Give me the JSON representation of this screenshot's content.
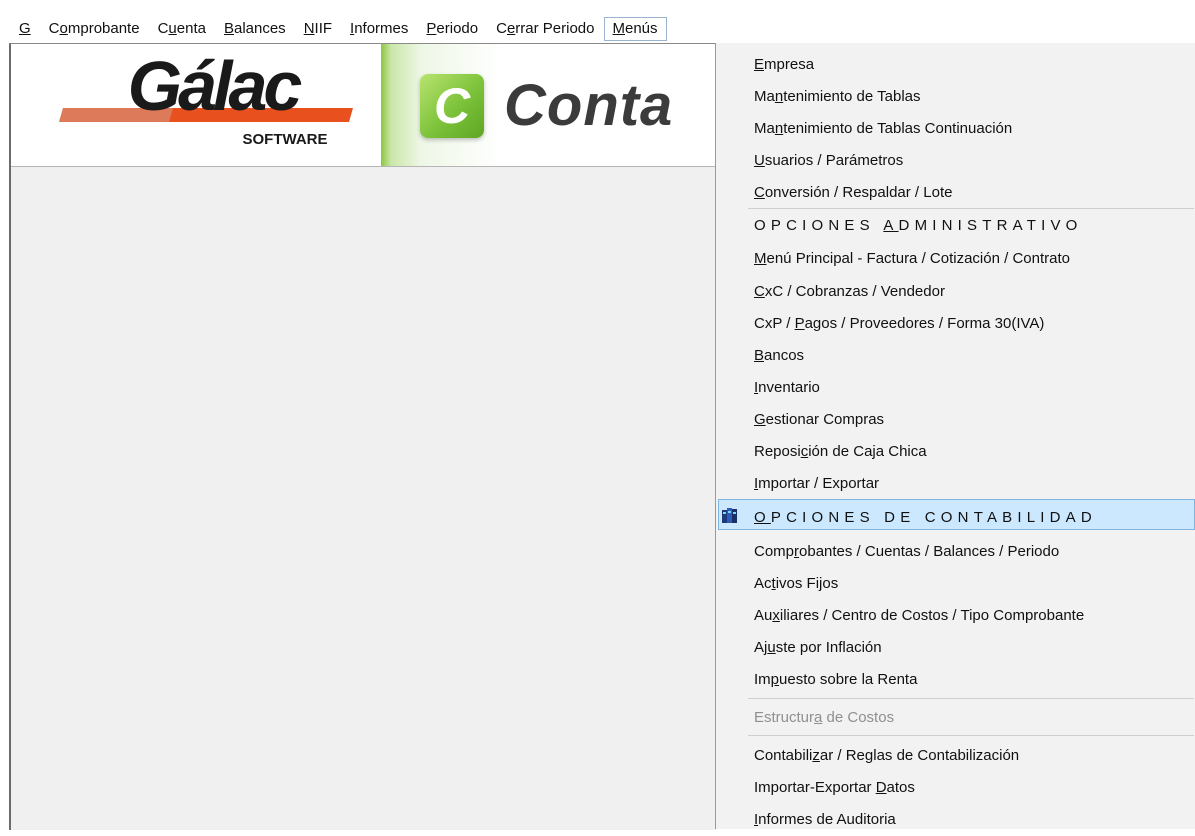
{
  "menubar": {
    "items": [
      {
        "pre": "",
        "acc": "G",
        "post": ""
      },
      {
        "pre": "C",
        "acc": "o",
        "post": "mprobante"
      },
      {
        "pre": "C",
        "acc": "u",
        "post": "enta"
      },
      {
        "pre": "",
        "acc": "B",
        "post": "alances"
      },
      {
        "pre": "",
        "acc": "N",
        "post": "IIF"
      },
      {
        "pre": "",
        "acc": "I",
        "post": "nformes"
      },
      {
        "pre": "",
        "acc": "P",
        "post": "eriodo"
      },
      {
        "pre": "C",
        "acc": "e",
        "post": "rrar Periodo"
      },
      {
        "pre": "",
        "acc": "M",
        "post": "enús"
      }
    ]
  },
  "banner": {
    "galac_logo_text": "Gálac",
    "galac_sub_text": "SOFTWARE",
    "c_badge_text": "C",
    "product_text": "Conta",
    "accent_colors": {
      "galac_dark": "#1a1a1a",
      "galac_orange": "#e8501e",
      "green": "#7cc23a"
    }
  },
  "dropdown": {
    "items": [
      {
        "pre": "",
        "acc": "E",
        "post": "mpresa"
      },
      {
        "pre": "Ma",
        "acc": "n",
        "post": "tenimiento de Tablas"
      },
      {
        "pre": "Ma",
        "acc": "n",
        "post": "tenimiento de Tablas Continuación"
      },
      {
        "pre": "",
        "acc": "U",
        "post": "suarios / Parámetros"
      },
      {
        "pre": "",
        "acc": "C",
        "post": "onversión / Respaldar / Lote"
      },
      {
        "pre": "OPCIONES ",
        "acc": "A",
        "post": "DMINISTRATIVO"
      },
      {
        "pre": "",
        "acc": "M",
        "post": "enú Principal - Factura / Cotización / Contrato"
      },
      {
        "pre": "",
        "acc": "C",
        "post": "xC / Cobranzas / Vendedor"
      },
      {
        "pre": "CxP / ",
        "acc": "P",
        "post": "agos / Proveedores / Forma 30(IVA)"
      },
      {
        "pre": "",
        "acc": "B",
        "post": "ancos"
      },
      {
        "pre": "",
        "acc": "I",
        "post": "nventario"
      },
      {
        "pre": "",
        "acc": "G",
        "post": "estionar Compras"
      },
      {
        "pre": "Reposi",
        "acc": "c",
        "post": "ión de Caja Chica"
      },
      {
        "pre": "",
        "acc": "I",
        "post": "mportar / Exportar"
      },
      {
        "pre": "",
        "acc": "O",
        "post": "PCIONES DE CONTABILIDAD"
      },
      {
        "pre": "Comp",
        "acc": "r",
        "post": "obantes / Cuentas / Balances / Periodo"
      },
      {
        "pre": "Ac",
        "acc": "t",
        "post": "ivos Fijos"
      },
      {
        "pre": "Au",
        "acc": "x",
        "post": "iliares / Centro de Costos / Tipo Comprobante"
      },
      {
        "pre": "Aj",
        "acc": "u",
        "post": "ste por Inflación"
      },
      {
        "pre": "Im",
        "acc": "p",
        "post": "uesto sobre la Renta"
      },
      {
        "pre": "Estructur",
        "acc": "a",
        "post": " de Costos"
      },
      {
        "pre": "Contabili",
        "acc": "z",
        "post": "ar / Reglas de Contabilización"
      },
      {
        "pre": "Importar-Exportar ",
        "acc": "D",
        "post": "atos"
      },
      {
        "pre": "",
        "acc": "I",
        "post": "nformes de Auditoria"
      }
    ],
    "highlight_icon": "books-icon",
    "highlight_color": "#cce8ff"
  }
}
